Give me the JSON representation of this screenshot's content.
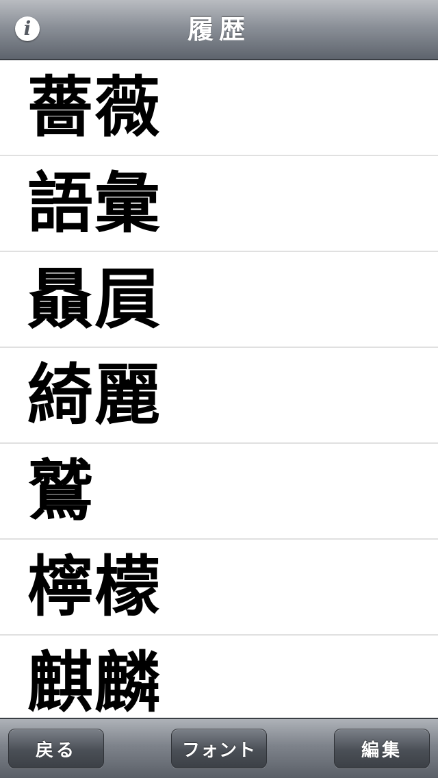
{
  "nav": {
    "title": "履歴",
    "info_label": "i"
  },
  "history": {
    "items": [
      {
        "word": "薔薇"
      },
      {
        "word": "語彙"
      },
      {
        "word": "贔屓"
      },
      {
        "word": "綺麗"
      },
      {
        "word": "鷲"
      },
      {
        "word": "檸檬"
      },
      {
        "word": "麒麟"
      }
    ]
  },
  "toolbar": {
    "back_label": "戻る",
    "font_label": "フォント",
    "edit_label": "編集"
  }
}
